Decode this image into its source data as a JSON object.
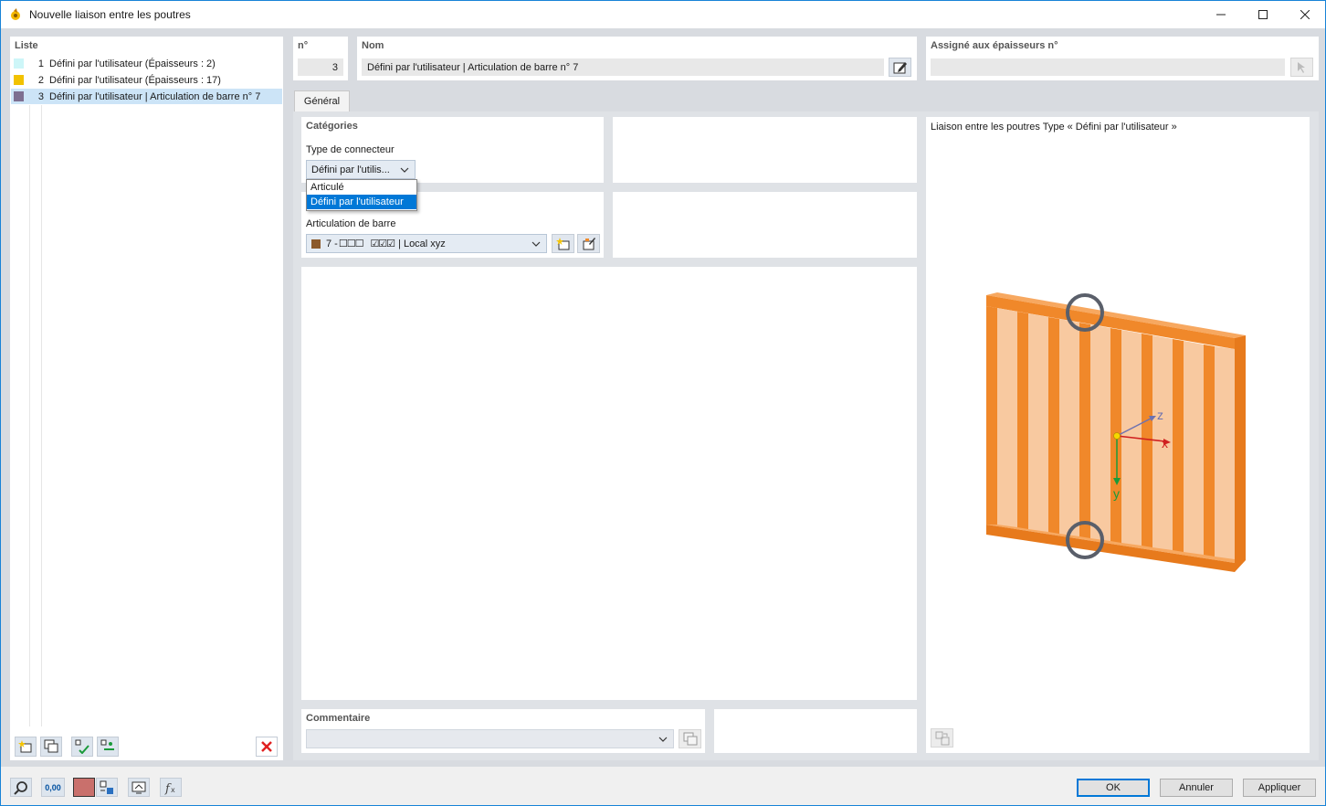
{
  "window": {
    "title": "Nouvelle liaison entre les poutres"
  },
  "list": {
    "header": "Liste",
    "items": [
      {
        "num": "1",
        "label": "Défini par l'utilisateur (Épaisseurs : 2)",
        "color": "#cdf6f8"
      },
      {
        "num": "2",
        "label": "Défini par l'utilisateur (Épaisseurs : 17)",
        "color": "#f2c200"
      },
      {
        "num": "3",
        "label": "Défini par l'utilisateur | Articulation de barre n° 7",
        "color": "#7d6f91"
      }
    ],
    "selected_index": 2
  },
  "header": {
    "no_label": "n°",
    "no_value": "3",
    "name_label": "Nom",
    "name_value": "Défini par l'utilisateur | Articulation de barre n° 7",
    "assigned_label": "Assigné aux épaisseurs n°",
    "assigned_value": ""
  },
  "tabs": [
    {
      "label": "Général"
    }
  ],
  "categories": {
    "title": "Catégories",
    "connector_type_label": "Type de connecteur",
    "connector_type_value": "Défini par l'utilis...",
    "options": [
      "Articulé",
      "Défini par l'utilisateur"
    ],
    "selected_option": 1
  },
  "hinge": {
    "label": "Articulation de barre",
    "value_prefix": "7 - ",
    "value_boxes_empty": "☐☐☐",
    "value_boxes_checked": "☑☑☑",
    "value_suffix": "| Local xyz",
    "color": "#8b5a2b"
  },
  "comment": {
    "label": "Commentaire",
    "value": ""
  },
  "preview": {
    "title": "Liaison entre les poutres Type « Défini par l'utilisateur »",
    "axes": {
      "x": "x",
      "y": "y",
      "z": "z"
    }
  },
  "buttons": {
    "ok": "OK",
    "cancel": "Annuler",
    "apply": "Appliquer"
  },
  "status_value": "0,00",
  "colors": {
    "accent": "#0078d7",
    "beam": "#f0882a",
    "beam_light": "#f8c9a0",
    "selection": "#cce4f7"
  }
}
